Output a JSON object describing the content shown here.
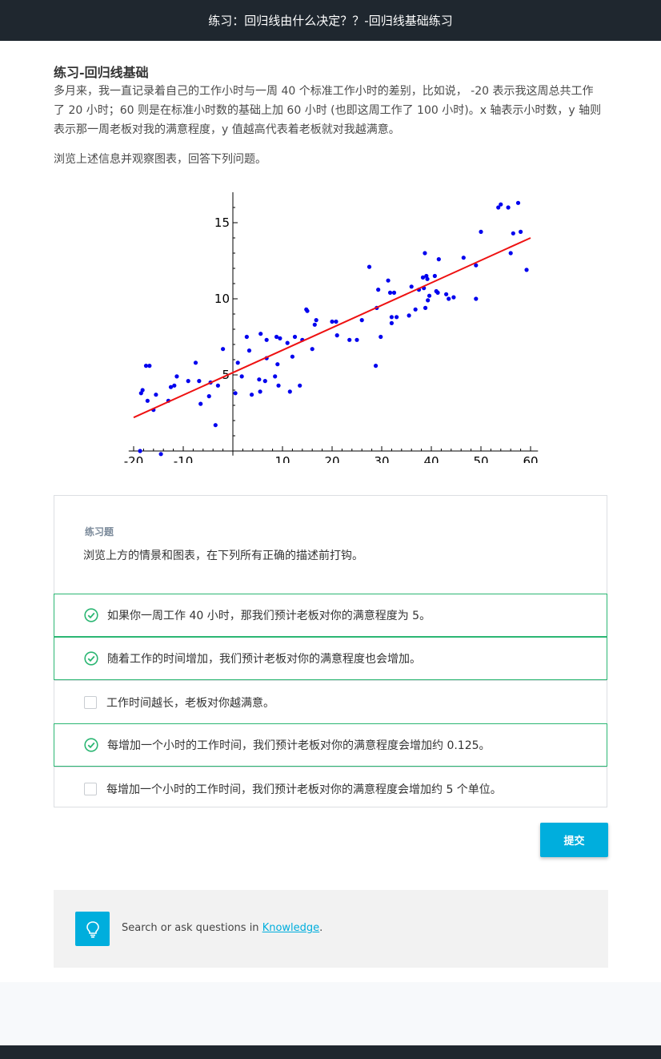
{
  "header": {
    "title": "练习：回归线由什么决定？？-回归线基础练习"
  },
  "lesson": {
    "heading": "练习-回归线基础",
    "paragraph1_line1": "多月来，我一直记录着自己的工作小时与一周 40 个标准工作小时的差别，比如说， -20 表示我这周总共工作",
    "paragraph1_line2": "了 20 小时；60 则是在标准小时数的基础上加 60 小时 (也即这周工作了 100 小时)。x 轴表示小时数，y 轴则",
    "paragraph1_line3": "表示那一周老板对我的满意程度，y 值越高代表着老板就对我越满意。",
    "paragraph2": "浏览上述信息并观察图表，回答下列问题。"
  },
  "chart_data": {
    "type": "scatter",
    "xlim": [
      -20,
      60
    ],
    "ylim": [
      0,
      17
    ],
    "x_ticks": [
      "-20",
      "-10",
      "10",
      "20",
      "30",
      "40",
      "50",
      "60"
    ],
    "y_ticks": [
      "5",
      "10",
      "15"
    ],
    "point_color": "#0000ee",
    "line_color": "#ee1111",
    "regression_line": {
      "x": [
        -20,
        60
      ],
      "y": [
        2.2,
        14
      ]
    },
    "points": [
      [
        -18.7,
        0
      ],
      [
        -18.5,
        3.8
      ],
      [
        -18.2,
        4
      ],
      [
        -17.5,
        5.6
      ],
      [
        -17.2,
        3.3
      ],
      [
        -16.8,
        5.6
      ],
      [
        -16,
        2.7
      ],
      [
        -15.5,
        3.7
      ],
      [
        -14.5,
        -0.2
      ],
      [
        -13,
        3.3
      ],
      [
        -12.5,
        4.2
      ],
      [
        -11.8,
        4.3
      ],
      [
        -11.3,
        4.9
      ],
      [
        -9,
        4.6
      ],
      [
        -7.5,
        5.8
      ],
      [
        -6.8,
        4.6
      ],
      [
        -6.5,
        3.1
      ],
      [
        -4.8,
        3.6
      ],
      [
        -4.5,
        4.5
      ],
      [
        -3.5,
        1.7
      ],
      [
        -3,
        4.3
      ],
      [
        -2,
        6.7
      ],
      [
        0.5,
        3.8
      ],
      [
        1,
        5.8
      ],
      [
        1.8,
        4.9
      ],
      [
        2.8,
        7.5
      ],
      [
        3.3,
        6.6
      ],
      [
        3.8,
        3.7
      ],
      [
        5.3,
        4.7
      ],
      [
        5.5,
        3.9
      ],
      [
        5.6,
        7.7
      ],
      [
        6.5,
        4.6
      ],
      [
        6.8,
        6.1
      ],
      [
        6.8,
        7.3
      ],
      [
        8.5,
        4.9
      ],
      [
        8.8,
        7.5
      ],
      [
        9,
        5.7
      ],
      [
        9.2,
        4.3
      ],
      [
        9.5,
        7.4
      ],
      [
        11,
        7.1
      ],
      [
        11.5,
        3.9
      ],
      [
        12,
        6.2
      ],
      [
        12.5,
        7.5
      ],
      [
        13.5,
        4.3
      ],
      [
        14,
        7.3
      ],
      [
        14.8,
        9.3
      ],
      [
        15,
        9.2
      ],
      [
        16,
        6.7
      ],
      [
        16.5,
        8.3
      ],
      [
        16.8,
        8.6
      ],
      [
        20,
        8.5
      ],
      [
        20.8,
        8.5
      ],
      [
        21,
        7.6
      ],
      [
        23.5,
        7.3
      ],
      [
        25,
        7.3
      ],
      [
        26,
        8.6
      ],
      [
        27.5,
        12.1
      ],
      [
        28.8,
        5.6
      ],
      [
        29,
        9.4
      ],
      [
        29.3,
        10.6
      ],
      [
        29.8,
        7.5
      ],
      [
        31.3,
        11.2
      ],
      [
        31.7,
        10.4
      ],
      [
        32,
        8.8
      ],
      [
        32,
        8.4
      ],
      [
        32.5,
        10.4
      ],
      [
        33,
        8.8
      ],
      [
        35.5,
        8.9
      ],
      [
        36,
        10.8
      ],
      [
        36.8,
        9.3
      ],
      [
        37.5,
        10.6
      ],
      [
        38.3,
        11.4
      ],
      [
        38.5,
        10.7
      ],
      [
        38.7,
        13
      ],
      [
        38.8,
        9.4
      ],
      [
        39,
        11.5
      ],
      [
        39.2,
        11.3
      ],
      [
        39.3,
        9.9
      ],
      [
        39.6,
        10.2
      ],
      [
        40.7,
        11.5
      ],
      [
        41,
        10.5
      ],
      [
        41.3,
        10.4
      ],
      [
        41.5,
        12.6
      ],
      [
        43,
        10.3
      ],
      [
        43.5,
        10
      ],
      [
        44.5,
        10.1
      ],
      [
        46.5,
        12.7
      ],
      [
        49,
        12.2
      ],
      [
        49,
        10
      ],
      [
        50,
        14.4
      ],
      [
        53.5,
        16
      ],
      [
        54,
        16.2
      ],
      [
        55.5,
        16
      ],
      [
        56,
        13
      ],
      [
        56.5,
        14.3
      ],
      [
        57.5,
        16.3
      ],
      [
        58,
        14.4
      ],
      [
        59.2,
        11.9
      ]
    ]
  },
  "quiz": {
    "label": "练习题",
    "question": "浏览上方的情景和图表，在下列所有正确的描述前打钩。",
    "options": [
      {
        "text": "如果你一周工作 40 小时，那我们预计老板对你的满意程度为 5。",
        "checked": true
      },
      {
        "text": "随着工作的时间增加，我们预计老板对你的满意程度也会增加。",
        "checked": true
      },
      {
        "text": "工作时间越长，老板对你越满意。",
        "checked": false
      },
      {
        "text": "每增加一个小时的工作时间，我们预计老板对你的满意程度会增加约 0.125。",
        "checked": true
      },
      {
        "text": "每增加一个小时的工作时间，我们预计老板对你的满意程度会增加约 5 个单位。",
        "checked": false
      }
    ],
    "submit_label": "提交"
  },
  "knowledge": {
    "prefix": "Search or ask questions in ",
    "link": "Knowledge",
    "suffix": "."
  },
  "colors": {
    "accent": "#00aedd",
    "check_green": "#2bb673",
    "header_bg": "#1f272f"
  }
}
